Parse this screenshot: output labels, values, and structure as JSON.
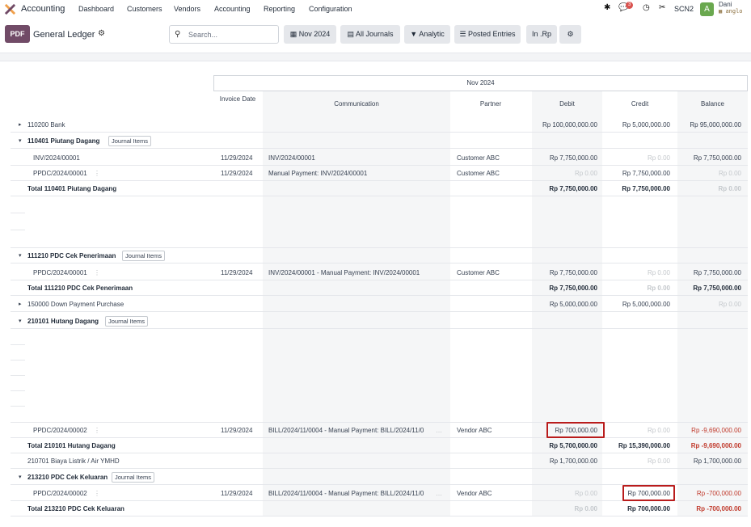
{
  "nav": {
    "app": "Accounting",
    "menu": [
      "Dashboard",
      "Customers",
      "Vendors",
      "Accounting",
      "Reporting",
      "Configuration"
    ],
    "message_count": "3",
    "company": "SCN2",
    "avatar": "A",
    "user": "Dani",
    "db": "anglo"
  },
  "control": {
    "pdf": "PDF",
    "title": "General Ledger",
    "search_placeholder": "Search...",
    "filters": [
      "Nov 2024",
      "All Journals",
      "Analytic",
      "Posted Entries",
      "In .Rp"
    ]
  },
  "table": {
    "period": "Nov 2024",
    "headers": {
      "date": "Invoice Date",
      "communication": "Communication",
      "partner": "Partner",
      "debit": "Debit",
      "credit": "Credit",
      "balance": "Balance"
    },
    "journal_items_label": "Journal Items",
    "rows": [
      {
        "name": "110200 Bank",
        "debit": "Rp 100,000,000.00",
        "credit": "Rp 5,000,000.00",
        "balance": "Rp 95,000,000.00"
      },
      {
        "name": "110401 Piutang Dagang"
      },
      {
        "name": "INV/2024/00001",
        "date": "11/29/2024",
        "comm": "INV/2024/00001",
        "partner": "Customer ABC",
        "debit": "Rp 7,750,000.00",
        "credit": "Rp 0.00",
        "balance": "Rp 7,750,000.00"
      },
      {
        "name": "PPDC/2024/00001",
        "date": "11/29/2024",
        "comm": "Manual Payment: INV/2024/00001",
        "partner": "Customer ABC",
        "debit": "Rp 0.00",
        "credit": "Rp 7,750,000.00",
        "balance": "Rp 0.00"
      },
      {
        "name": "Total 110401 Piutang Dagang",
        "debit": "Rp 7,750,000.00",
        "credit": "Rp 7,750,000.00",
        "balance": "Rp 0.00"
      },
      {
        "name": "111210 PDC Cek Penerimaan"
      },
      {
        "name": "PPDC/2024/00001",
        "date": "11/29/2024",
        "comm": "INV/2024/00001 - Manual Payment: INV/2024/00001",
        "partner": "Customer ABC",
        "debit": "Rp 7,750,000.00",
        "credit": "Rp 0.00",
        "balance": "Rp 7,750,000.00"
      },
      {
        "name": "Total 111210 PDC Cek Penerimaan",
        "debit": "Rp 7,750,000.00",
        "credit": "Rp 0.00",
        "balance": "Rp 7,750,000.00"
      },
      {
        "name": "150000 Down Payment Purchase",
        "debit": "Rp 5,000,000.00",
        "credit": "Rp 5,000,000.00",
        "balance": "Rp 0.00"
      },
      {
        "name": "210101 Hutang Dagang"
      },
      {
        "name": "PPDC/2024/00002",
        "date": "11/29/2024",
        "comm": "BILL/2024/11/0004 - Manual Payment: BILL/2024/11/0",
        "partner": "Vendor ABC",
        "debit": "Rp 700,000.00",
        "credit": "Rp 0.00",
        "balance": "Rp -9,690,000.00"
      },
      {
        "name": "Total 210101 Hutang Dagang",
        "debit": "Rp 5,700,000.00",
        "credit": "Rp 15,390,000.00",
        "balance": "Rp -9,690,000.00"
      },
      {
        "name": "210701 Biaya Listrik / Air YMHD",
        "debit": "Rp 1,700,000.00",
        "credit": "Rp 0.00",
        "balance": "Rp 1,700,000.00"
      },
      {
        "name": "213210 PDC Cek Keluaran"
      },
      {
        "name": "PPDC/2024/00002",
        "date": "11/29/2024",
        "comm": "BILL/2024/11/0004 - Manual Payment: BILL/2024/11/0",
        "partner": "Vendor ABC",
        "debit": "Rp 0.00",
        "credit": "Rp 700,000.00",
        "balance": "Rp -700,000.00"
      },
      {
        "name": "Total 213210 PDC Cek Keluaran",
        "debit": "Rp 0.00",
        "credit": "Rp 700,000.00",
        "balance": "Rp -700,000.00"
      }
    ]
  },
  "colors": {
    "brand": "#714b67",
    "negative": "#c0392b",
    "highlight": "#b91c1c"
  }
}
